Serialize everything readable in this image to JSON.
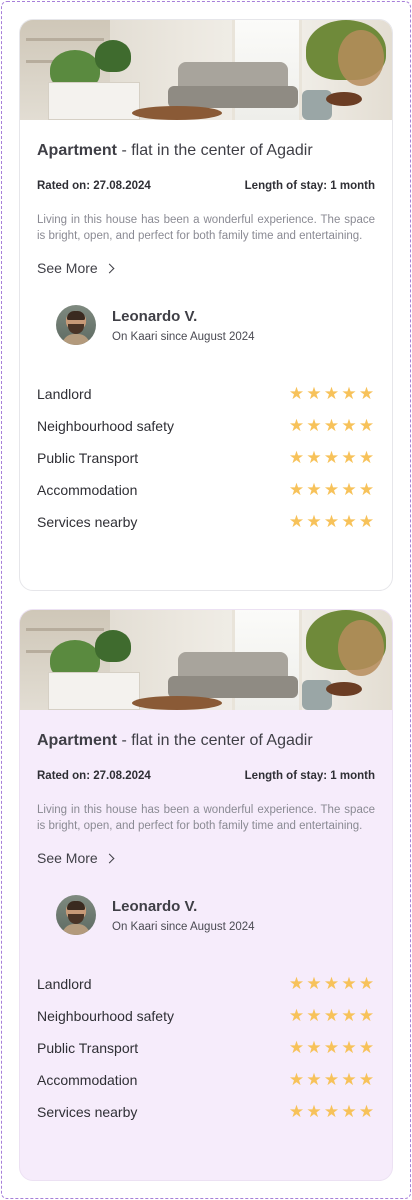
{
  "colors": {
    "star": "#f7c25a",
    "card_highlight_bg": "#f6ecfb",
    "frame_border": "#a77fd9"
  },
  "cards": [
    {
      "title_strong": "Apartment",
      "title_rest": " - flat in the center of Agadir",
      "rated_on": "Rated on: 27.08.2024",
      "length_of_stay": "Length of stay: 1 month",
      "description": "Living in this house has been a wonderful experience. The space is bright, open, and perfect for both family time and entertaining.",
      "see_more": "See More",
      "reviewer": {
        "name": "Leonardo V.",
        "since": "On Kaari since August 2024"
      },
      "ratings": [
        {
          "label": "Landlord",
          "stars": 5
        },
        {
          "label": "Neighbourhood safety",
          "stars": 5
        },
        {
          "label": "Public Transport",
          "stars": 5
        },
        {
          "label": "Accommodation",
          "stars": 5
        },
        {
          "label": "Services nearby",
          "stars": 5
        }
      ]
    },
    {
      "title_strong": "Apartment",
      "title_rest": " - flat in the center of Agadir",
      "rated_on": "Rated on: 27.08.2024",
      "length_of_stay": "Length of stay: 1 month",
      "description": "Living in this house has been a wonderful experience. The space is bright, open, and perfect for both family time and entertaining.",
      "see_more": "See More",
      "reviewer": {
        "name": "Leonardo V.",
        "since": "On Kaari since August 2024"
      },
      "ratings": [
        {
          "label": "Landlord",
          "stars": 5
        },
        {
          "label": "Neighbourhood safety",
          "stars": 5
        },
        {
          "label": "Public Transport",
          "stars": 5
        },
        {
          "label": "Accommodation",
          "stars": 5
        },
        {
          "label": "Services nearby",
          "stars": 5
        }
      ]
    }
  ]
}
